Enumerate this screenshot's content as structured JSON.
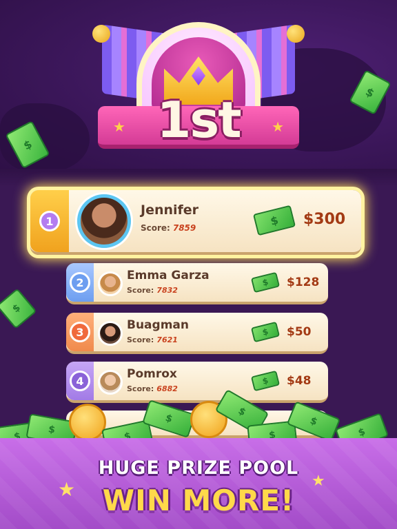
{
  "banner": {
    "rank_title": "1st"
  },
  "leaderboard": [
    {
      "rank": "1",
      "name": "Jennifer",
      "score_label": "Score:",
      "score": "7859",
      "prize": "$300",
      "badge_color": "#b47cf0"
    },
    {
      "rank": "2",
      "name": "Emma Garza",
      "score_label": "Score:",
      "score": "7832",
      "prize": "$128",
      "badge_color": "#6d9ef0"
    },
    {
      "rank": "3",
      "name": "Buagman",
      "score_label": "Score:",
      "score": "7621",
      "prize": "$50",
      "badge_color": "#f08a4c"
    },
    {
      "rank": "4",
      "name": "Pomrox",
      "score_label": "Score:",
      "score": "6882",
      "prize": "$48",
      "badge_color": "#a27be6"
    }
  ],
  "cash_symbol": "$",
  "promo": {
    "line1": "HUGE PRIZE POOL",
    "line2": "WIN MORE!"
  },
  "icons": [
    "crown-icon",
    "medal-icon",
    "cash-icon",
    "coin-icon",
    "star-icon"
  ],
  "colors": {
    "highlight": "#ffe15a",
    "prize_text": "#a33a14",
    "bottom_bg": "#b65ed8"
  }
}
